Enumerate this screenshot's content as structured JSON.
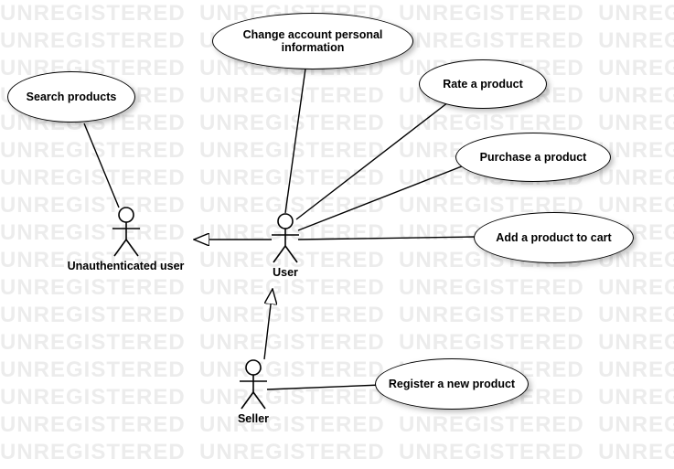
{
  "diagram_type": "UML Use Case Diagram",
  "watermark": "UNREGISTERED",
  "actors": {
    "unauth": {
      "label": "Unauthenticated user"
    },
    "user": {
      "label": "User"
    },
    "seller": {
      "label": "Seller"
    }
  },
  "use_cases": {
    "search": {
      "label": "Search products"
    },
    "change": {
      "label": "Change account personal information"
    },
    "rate": {
      "label": "Rate a product"
    },
    "purchase": {
      "label": "Purchase a product"
    },
    "addcart": {
      "label": "Add a product to cart"
    },
    "register": {
      "label": "Register a new product"
    }
  },
  "relations": [
    {
      "type": "association",
      "from": "unauth",
      "to": "search"
    },
    {
      "type": "association",
      "from": "user",
      "to": "change"
    },
    {
      "type": "association",
      "from": "user",
      "to": "rate"
    },
    {
      "type": "association",
      "from": "user",
      "to": "purchase"
    },
    {
      "type": "association",
      "from": "user",
      "to": "addcart"
    },
    {
      "type": "association",
      "from": "seller",
      "to": "register"
    },
    {
      "type": "generalization",
      "from": "user",
      "to": "unauth"
    },
    {
      "type": "generalization",
      "from": "seller",
      "to": "user"
    }
  ]
}
